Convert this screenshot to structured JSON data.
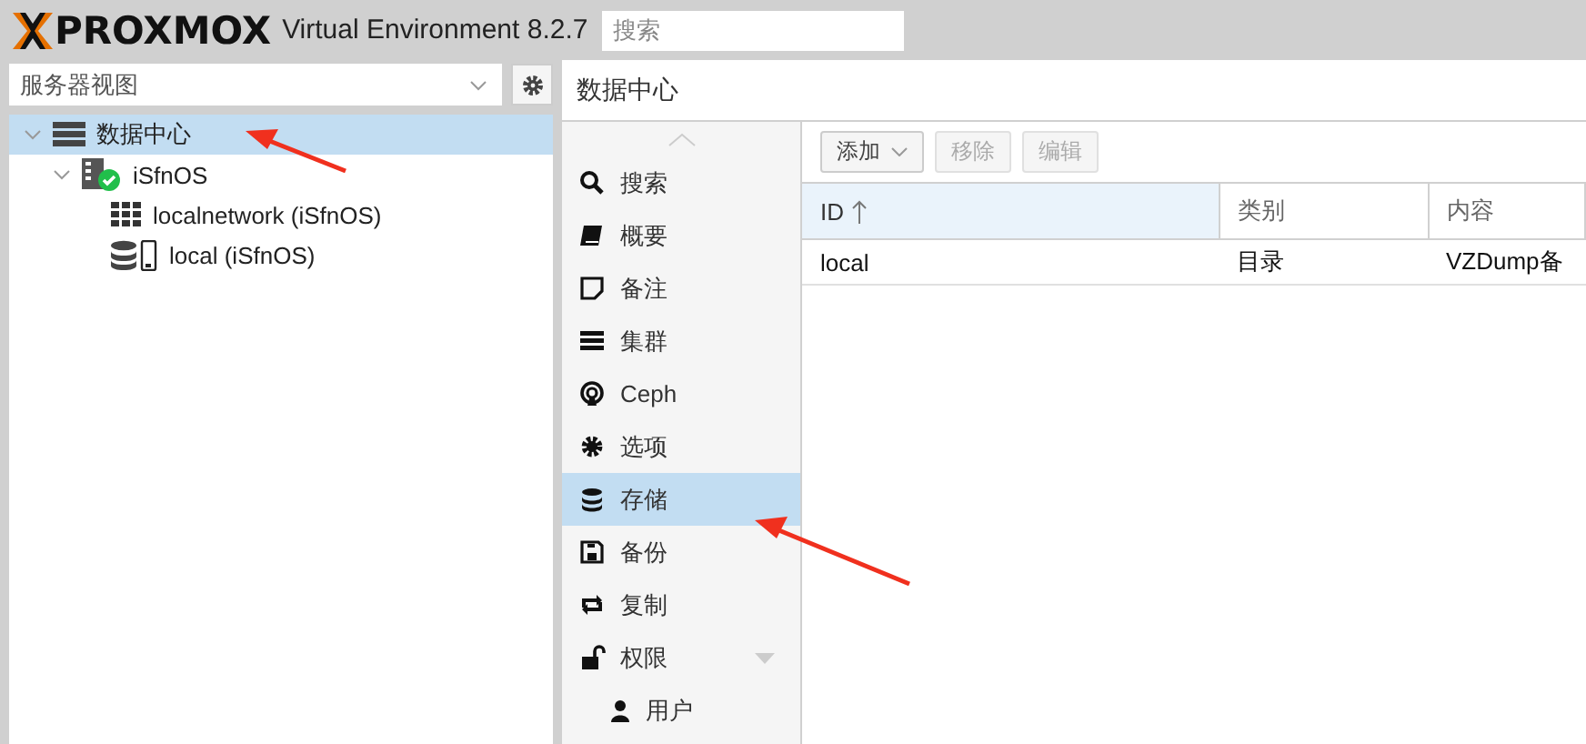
{
  "header": {
    "brand": "PROXMOX",
    "product": "Virtual Environment 8.2.7",
    "search": {
      "placeholder": "搜索"
    }
  },
  "view_selector": {
    "value": "服务器视图"
  },
  "tree": [
    {
      "label": "数据中心",
      "kind": "datacenter",
      "selected": true,
      "expanded": true,
      "children": [
        {
          "label": "iSfnOS",
          "kind": "node",
          "selected": false,
          "expanded": true,
          "children": [
            {
              "label": "localnetwork (iSfnOS)",
              "kind": "network",
              "selected": false
            },
            {
              "label": "local (iSfnOS)",
              "kind": "storage",
              "selected": false
            }
          ]
        }
      ]
    }
  ],
  "panel_title": "数据中心",
  "nav": [
    {
      "label": "搜索",
      "selected": false
    },
    {
      "label": "概要",
      "selected": false
    },
    {
      "label": "备注",
      "selected": false
    },
    {
      "label": "集群",
      "selected": false
    },
    {
      "label": "Ceph",
      "selected": false
    },
    {
      "label": "选项",
      "selected": false
    },
    {
      "label": "存储",
      "selected": true
    },
    {
      "label": "备份",
      "selected": false
    },
    {
      "label": "复制",
      "selected": false
    },
    {
      "label": "权限",
      "selected": false,
      "expanded": true,
      "children": [
        {
          "label": "用户",
          "selected": false
        }
      ]
    }
  ],
  "toolbar": [
    {
      "label": "添加",
      "disabled": false,
      "dropdown": true
    },
    {
      "label": "移除",
      "disabled": true,
      "dropdown": false
    },
    {
      "label": "编辑",
      "disabled": true,
      "dropdown": false
    }
  ],
  "table": {
    "columns": [
      {
        "label": "ID",
        "sorted": true
      },
      {
        "label": "类别",
        "sorted": false
      },
      {
        "label": "内容",
        "sorted": false
      }
    ],
    "rows": [
      [
        "local",
        "目录",
        "VZDump备"
      ]
    ]
  }
}
